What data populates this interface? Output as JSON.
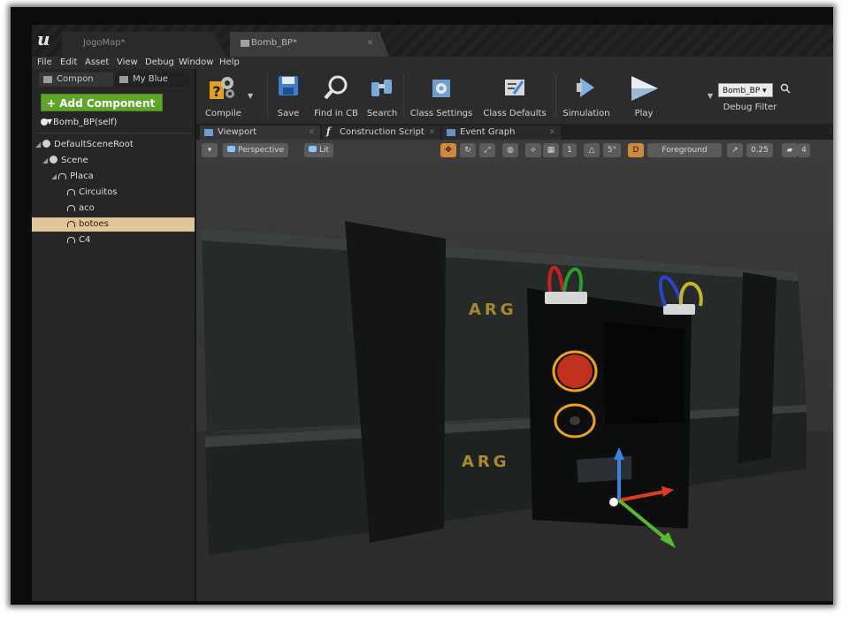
{
  "document_tabs": [
    {
      "label": "JogoMap*"
    },
    {
      "label": "Bomb_BP*"
    }
  ],
  "menu": [
    "File",
    "Edit",
    "Asset",
    "View",
    "Debug",
    "Window",
    "Help"
  ],
  "left_panel": {
    "tabs": [
      {
        "label": "Compon"
      },
      {
        "label": "My Blue"
      }
    ],
    "add_component_label": "+ Add Component ▾",
    "self_label": "Bomb_BP(self)",
    "tree": [
      {
        "label": "DefaultSceneRoot",
        "icon": "scene-root-icon",
        "depth": 0,
        "expanded": true,
        "selected": false
      },
      {
        "label": "Scene",
        "icon": "scene-component-icon",
        "depth": 1,
        "expanded": true,
        "selected": false
      },
      {
        "label": "Placa",
        "icon": "static-mesh-icon",
        "depth": 2,
        "expanded": true,
        "selected": false
      },
      {
        "label": "Circuitos",
        "icon": "static-mesh-icon",
        "depth": 3,
        "expanded": false,
        "selected": false
      },
      {
        "label": "aco",
        "icon": "static-mesh-icon",
        "depth": 3,
        "expanded": false,
        "selected": false
      },
      {
        "label": "botoes",
        "icon": "static-mesh-icon",
        "depth": 3,
        "expanded": false,
        "selected": true
      },
      {
        "label": "C4",
        "icon": "static-mesh-icon",
        "depth": 3,
        "expanded": false,
        "selected": false
      }
    ]
  },
  "toolbar": {
    "compile": "Compile",
    "save": "Save",
    "find_in_cb": "Find in CB",
    "search": "Search",
    "class_settings": "Class Settings",
    "class_defaults": "Class Defaults",
    "simulation": "Simulation",
    "play": "Play",
    "debug_object": "Bomb_BP ▾",
    "debug_filter": "Debug Filter"
  },
  "editor_tabs": [
    {
      "label": "Viewport",
      "icon": "viewport-icon"
    },
    {
      "label": "Construction Script",
      "icon": "function-icon"
    },
    {
      "label": "Event Graph",
      "icon": "event-graph-icon"
    }
  ],
  "viewport": {
    "view_mode": "Perspective",
    "lighting": "Lit",
    "grid_snap": "5°",
    "layer": "Foreground",
    "scale_snap": "0.25",
    "camera_speed": "4",
    "decal_text": "ARG"
  },
  "colors": {
    "add_component": "#5fa52b",
    "selection": "#e0c59a",
    "gizmo_x": "#e03a25",
    "gizmo_y": "#5ab82c",
    "gizmo_z": "#3b82e0",
    "highlight_ring": "#f0a020"
  }
}
